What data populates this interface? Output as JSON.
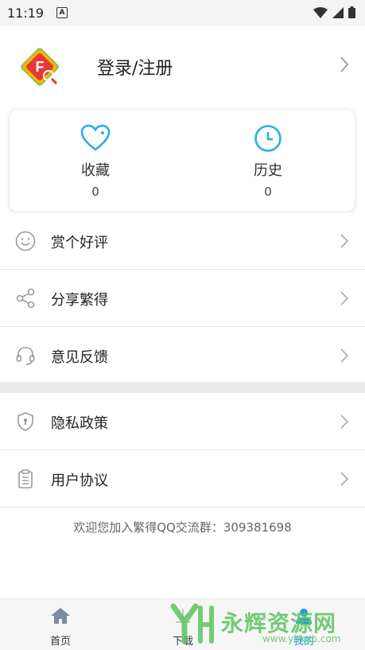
{
  "status_bar": {
    "time": "11:19",
    "notification_letter": "A"
  },
  "profile": {
    "login_label": "登录/注册"
  },
  "stats": [
    {
      "label": "收藏",
      "count": "0"
    },
    {
      "label": "历史",
      "count": "0"
    }
  ],
  "menu_group_1": [
    {
      "label": "赏个好评",
      "icon": "smiley-icon"
    },
    {
      "label": "分享繁得",
      "icon": "share-icon"
    },
    {
      "label": "意见反馈",
      "icon": "headset-icon"
    }
  ],
  "menu_group_2": [
    {
      "label": "隐私政策",
      "icon": "shield-icon"
    },
    {
      "label": "用户协议",
      "icon": "clipboard-icon"
    }
  ],
  "footer_text": "欢迎您加入繁得QQ交流群：309381698",
  "tabs": [
    {
      "label": "首页"
    },
    {
      "label": "下载"
    },
    {
      "label": "我的"
    }
  ],
  "watermark": {
    "text": "永辉资源网",
    "url": "www.yhkgb.com"
  },
  "colors": {
    "accent": "#2aaee6",
    "active_tab": "#2196f3"
  }
}
